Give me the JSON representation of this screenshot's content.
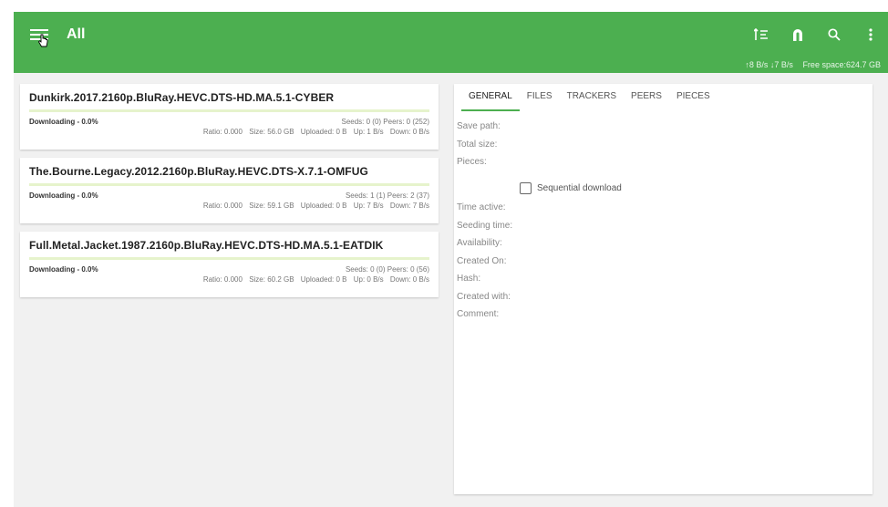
{
  "appbar": {
    "title": "All",
    "icons": [
      "menu-icon",
      "sort-icon",
      "magnet-icon",
      "search-icon",
      "more-vert-icon"
    ],
    "speed": "↑8 B/s ↓7 B/s",
    "free_space": "Free space:624.7 GB",
    "color": "#4caf50"
  },
  "torrents": [
    {
      "name": "Dunkirk.2017.2160p.BluRay.HEVC.DTS-HD.MA.5.1-CYBER",
      "status": "Downloading - 0.0%",
      "progress": 0.0,
      "seeds_peers": "Seeds: 0 (0)  Peers: 0 (252)",
      "ratio": "Ratio: 0.000",
      "size": "Size: 56.0 GB",
      "uploaded": "Uploaded: 0 B",
      "up": "Up: 1 B/s",
      "down": "Down: 0 B/s"
    },
    {
      "name": "The.Bourne.Legacy.2012.2160p.BluRay.HEVC.DTS-X.7.1-OMFUG",
      "status": "Downloading - 0.0%",
      "progress": 0.0,
      "seeds_peers": "Seeds: 1 (1)  Peers: 2 (37)",
      "ratio": "Ratio: 0.000",
      "size": "Size: 59.1 GB",
      "uploaded": "Uploaded: 0 B",
      "up": "Up: 7 B/s",
      "down": "Down: 7 B/s"
    },
    {
      "name": "Full.Metal.Jacket.1987.2160p.BluRay.HEVC.DTS-HD.MA.5.1-EATDIK",
      "status": "Downloading - 0.0%",
      "progress": 0.0,
      "seeds_peers": "Seeds: 0 (0)  Peers: 0 (56)",
      "ratio": "Ratio: 0.000",
      "size": "Size: 60.2 GB",
      "uploaded": "Uploaded: 0 B",
      "up": "Up: 0 B/s",
      "down": "Down: 0 B/s"
    }
  ],
  "detail": {
    "tabs": [
      "GENERAL",
      "FILES",
      "TRACKERS",
      "PEERS",
      "PIECES"
    ],
    "active_tab": "GENERAL",
    "fields_top": [
      "Save path:",
      "Total size:",
      "Pieces:"
    ],
    "sequential_label": "Sequential download",
    "sequential_checked": false,
    "fields_bottom": [
      "Time active:",
      "Seeding time:",
      "Availability:",
      "Created On:",
      "Hash:",
      "Created with:",
      "Comment:"
    ]
  }
}
